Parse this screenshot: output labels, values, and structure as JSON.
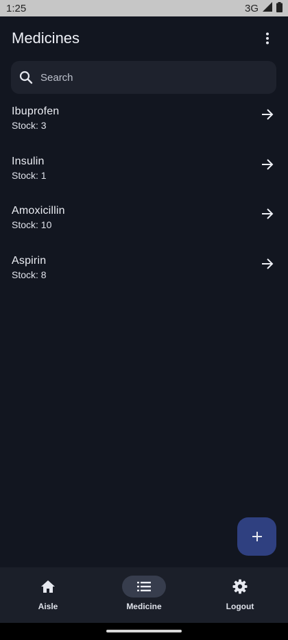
{
  "status_bar": {
    "time": "1:25",
    "network": "3G"
  },
  "app_bar": {
    "title": "Medicines",
    "menu_icon": "more-vert-icon"
  },
  "search": {
    "placeholder": "Search",
    "value": "",
    "icon": "search-icon"
  },
  "medicines": [
    {
      "name": "Ibuprofen",
      "stock": "Stock: 3"
    },
    {
      "name": "Insulin",
      "stock": "Stock: 1"
    },
    {
      "name": "Amoxicillin",
      "stock": "Stock: 10"
    },
    {
      "name": "Aspirin",
      "stock": "Stock: 8"
    }
  ],
  "fab": {
    "icon": "plus-icon"
  },
  "bottom_nav": {
    "items": [
      {
        "label": "Aisle",
        "icon": "home-icon",
        "active": false
      },
      {
        "label": "Medicine",
        "icon": "list-icon",
        "active": true
      },
      {
        "label": "Logout",
        "icon": "gear-icon",
        "active": false
      }
    ]
  },
  "colors": {
    "background": "#121620",
    "surface": "#1e222d",
    "nav_background": "#1b1f29",
    "fab": "#2f4080",
    "active_pill": "#373d4d"
  }
}
